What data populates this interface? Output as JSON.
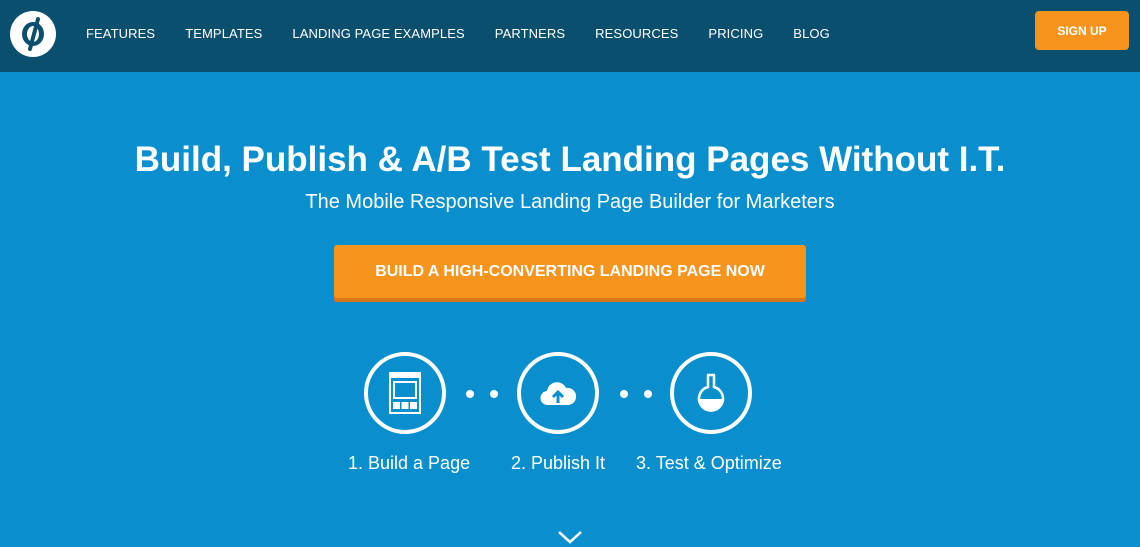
{
  "nav": {
    "logo": "unbounce-logo",
    "items": [
      "FEATURES",
      "TEMPLATES",
      "LANDING PAGE EXAMPLES",
      "PARTNERS",
      "RESOURCES",
      "PRICING",
      "BLOG"
    ],
    "signup_label": "SIGN UP"
  },
  "hero": {
    "headline": "Build, Publish & A/B Test Landing Pages Without I.T.",
    "subheadline": "The Mobile Responsive Landing Page Builder for Marketers",
    "cta_label": "BUILD A HIGH-CONVERTING LANDING PAGE NOW"
  },
  "steps": [
    {
      "icon": "page-layout-icon",
      "label": "1. Build a Page"
    },
    {
      "icon": "cloud-upload-icon",
      "label": "2. Publish It"
    },
    {
      "icon": "flask-icon",
      "label": "3. Test & Optimize"
    }
  ],
  "scroll_indicator": "chevron-down-icon",
  "colors": {
    "nav_bg": "#0a4f6d",
    "hero_bg": "#0a8fce",
    "accent": "#f7941d"
  }
}
